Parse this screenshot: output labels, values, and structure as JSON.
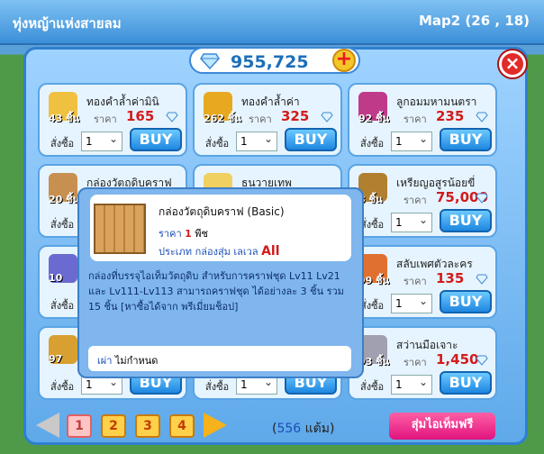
{
  "location": "ทุ่งหญ้าแห่งสายลม",
  "map_coords": "Map2 (26 , 18)",
  "currency": {
    "value": "955,725",
    "icon": "diamond-icon"
  },
  "labels": {
    "price": "ราคา",
    "order": "สั่งซื้อ",
    "buy": "BUY",
    "qty": "1"
  },
  "items": [
    {
      "name": "ทองคำล้ำค่ามินิ",
      "count": "43 ชิ้น",
      "price": "165",
      "thumb_color": "#f0c040"
    },
    {
      "name": "ทองคำล้ำค่า",
      "count": "262 ชิ้น",
      "price": "325",
      "thumb_color": "#e8a820"
    },
    {
      "name": "ลูกอมมหามนตรา",
      "count": "92 ชิ้น",
      "price": "235",
      "thumb_color": "#c03a8a"
    },
    {
      "name": "กล่องวัตถุดิบคราฟ",
      "count": "20 ชิ้น",
      "price": "",
      "thumb_color": "#c89050"
    },
    {
      "name": "ธนวายเทพ",
      "count": "",
      "price": "",
      "thumb_color": "#f0d060"
    },
    {
      "name": "เหรียญอสูรน้อยขี่",
      "count": "8 ชิ้น",
      "price": "75,000",
      "thumb_color": "#b08030"
    },
    {
      "name": "",
      "count": "10",
      "price": "",
      "thumb_color": "#6a6ad0"
    },
    {
      "name": "",
      "count": "",
      "price": "",
      "thumb_color": "#e0e0e0"
    },
    {
      "name": "สลับเพศตัวละคร",
      "count": "99 ชิ้น",
      "price": "135",
      "thumb_color": "#e07030"
    },
    {
      "name": "",
      "count": "97",
      "price": "",
      "thumb_color": "#d8a030"
    },
    {
      "name": "",
      "count": "",
      "price": "",
      "thumb_color": "#e0e0e0"
    },
    {
      "name": "สว่านมือเจาะ",
      "count": "93 ชิ้น",
      "price": "1,450",
      "thumb_color": "#a0a0b0"
    }
  ],
  "tooltip": {
    "name": "กล่องวัตถุดิบคราฟ (Basic)",
    "price_label": "ราคา",
    "price_value": "1",
    "price_unit": "พีช",
    "type_label": "ประเภท",
    "type_value": "กล่องสุ่ม",
    "level_label": "เลเวล",
    "level_value": "All",
    "description": "กล่องที่บรรจุไอเท็มวัตถุดิบ สำหรับการคราฟชุด Lv11 Lv21 และ Lv111-Lv113 สามารถคราฟชุด ได้อย่างละ 3 ชิ้น รวม 15 ชิ้น [หาซื้อได้จาก พรีเมี่ยมช็อป]",
    "foot_label": "เผ่า",
    "foot_value": "ไม่กำหนด"
  },
  "pager": {
    "pages": [
      "1",
      "2",
      "3",
      "4"
    ],
    "active": "1",
    "total_open": "(",
    "total_count": "556",
    "total_unit": "แต้ม)"
  },
  "random_button": "สุ่มไอเท็มฟรี"
}
